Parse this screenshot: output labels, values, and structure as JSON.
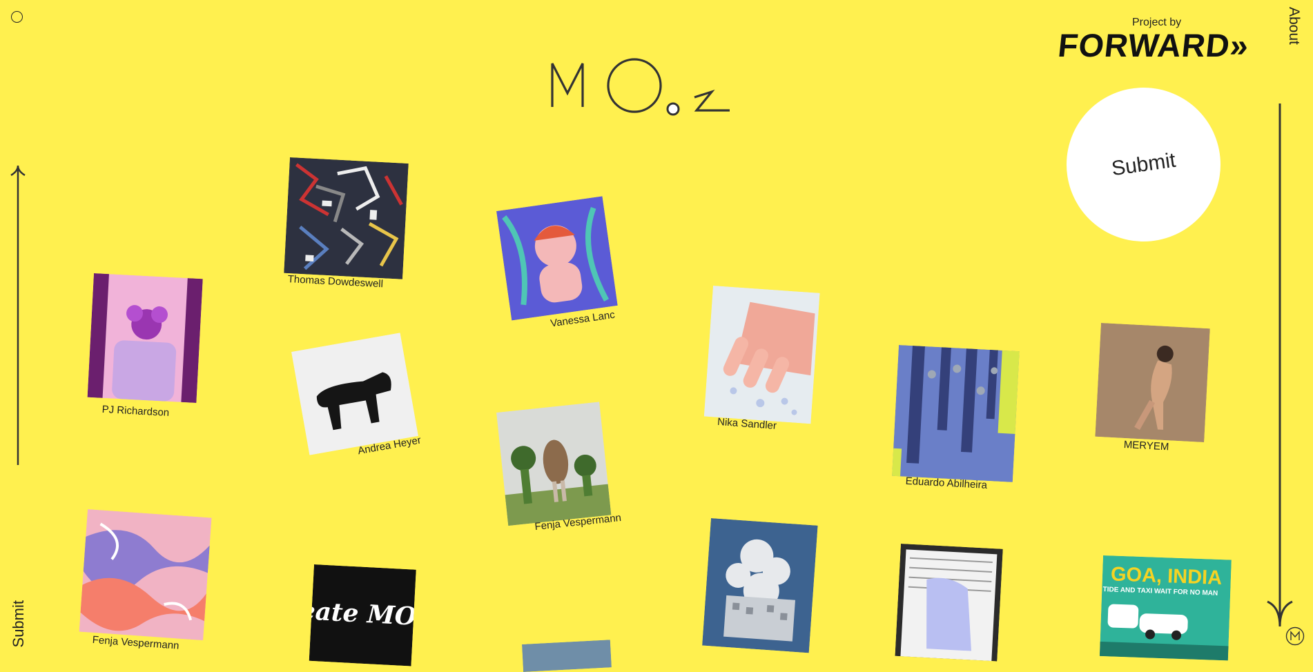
{
  "header": {
    "project_by": "Project by",
    "partner_logo": "FORWARD»",
    "about_label": "About",
    "submit_circle_label": "Submit",
    "submit_vertical_label": "Submit",
    "logo_alt": "MO.Z"
  },
  "icons": {
    "menu": "circle-menu-icon",
    "scroll_up": "arrow-up-icon",
    "scroll_down": "arrow-down-icon",
    "corner": "mo-badge-icon"
  },
  "colors": {
    "background": "#fff04f",
    "ink": "#222222",
    "submit_fill": "#ffffff"
  },
  "artworks": [
    {
      "artist": "Thomas Dowdeswell",
      "art_icon": "abstract-mosaic-art"
    },
    {
      "artist": "Vanessa Lanc",
      "art_icon": "illustrated-face-art"
    },
    {
      "artist": "PJ Richardson",
      "art_icon": "pink-robe-figure-art"
    },
    {
      "artist": "Andrea Heyer",
      "art_icon": "black-bear-sculpture-art"
    },
    {
      "artist": "Nika Sandler",
      "art_icon": "nails-art"
    },
    {
      "artist": "Fenja Vespermann",
      "art_icon": "topiary-garden-art"
    },
    {
      "artist": "Eduardo Abilheira",
      "art_icon": "blue-drip-art"
    },
    {
      "artist": "MERYEM",
      "art_icon": "figure-photo-art"
    },
    {
      "artist": "Fenja Vespermann",
      "art_icon": "liquid-swirl-art"
    },
    {
      "artist": "",
      "art_icon": "create-more-poster-art",
      "poster_text": "Create MORE"
    },
    {
      "artist": "",
      "art_icon": "cloud-structure-art"
    },
    {
      "artist": "",
      "art_icon": "newspaper-hands-art"
    },
    {
      "artist": "",
      "art_icon": "goa-india-poster-art",
      "poster_title": "GOA, INDIA",
      "poster_sub": "WHERE TIME TIDE AND TAXI WAIT FOR NO MAN"
    },
    {
      "artist": "",
      "art_icon": "sky-peek-art"
    }
  ]
}
